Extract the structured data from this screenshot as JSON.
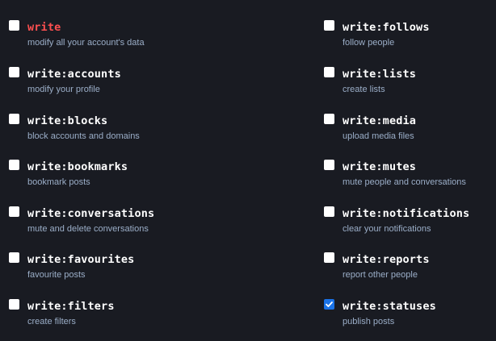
{
  "scopes_left": [
    {
      "name": "write",
      "description": "modify all your account's data",
      "checked": false,
      "danger": true
    },
    {
      "name": "write:accounts",
      "description": "modify your profile",
      "checked": false,
      "danger": false
    },
    {
      "name": "write:blocks",
      "description": "block accounts and domains",
      "checked": false,
      "danger": false
    },
    {
      "name": "write:bookmarks",
      "description": "bookmark posts",
      "checked": false,
      "danger": false
    },
    {
      "name": "write:conversations",
      "description": "mute and delete conversations",
      "checked": false,
      "danger": false
    },
    {
      "name": "write:favourites",
      "description": "favourite posts",
      "checked": false,
      "danger": false
    },
    {
      "name": "write:filters",
      "description": "create filters",
      "checked": false,
      "danger": false
    }
  ],
  "scopes_right": [
    {
      "name": "write:follows",
      "description": "follow people",
      "checked": false,
      "danger": false
    },
    {
      "name": "write:lists",
      "description": "create lists",
      "checked": false,
      "danger": false
    },
    {
      "name": "write:media",
      "description": "upload media files",
      "checked": false,
      "danger": false
    },
    {
      "name": "write:mutes",
      "description": "mute people and conversations",
      "checked": false,
      "danger": false
    },
    {
      "name": "write:notifications",
      "description": "clear your notifications",
      "checked": false,
      "danger": false
    },
    {
      "name": "write:reports",
      "description": "report other people",
      "checked": false,
      "danger": false
    },
    {
      "name": "write:statuses",
      "description": "publish posts",
      "checked": true,
      "danger": false
    }
  ],
  "colors": {
    "background": "#191b22",
    "scope_name": "#ffffff",
    "scope_name_danger": "#ff5050",
    "description": "#9baec8",
    "checkbox_checked": "#1a73e8"
  }
}
